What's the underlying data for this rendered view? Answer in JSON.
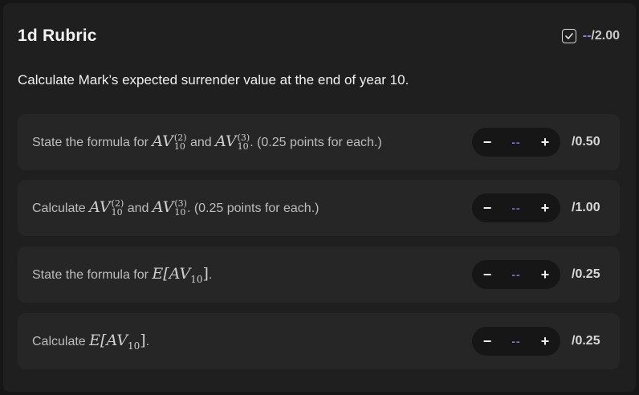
{
  "header": {
    "title": "1d Rubric",
    "score_current": "--",
    "score_total": "/2.00"
  },
  "question": "Calculate Mark’s expected surrender value at the end of year 10.",
  "items": [
    {
      "prefix": "State the formula for ",
      "sym1": "AV",
      "sup1": "(2)",
      "sub1": "10",
      "mid": " and ",
      "sym2": "AV",
      "sup2": "(3)",
      "sub2": "10",
      "suffix": ". (0.25 points for each.)",
      "value": "--",
      "max": "/0.50"
    },
    {
      "prefix": "Calculate ",
      "sym1": "AV",
      "sup1": "(2)",
      "sub1": "10",
      "mid": " and ",
      "sym2": "AV",
      "sup2": "(3)",
      "sub2": "10",
      "suffix": ". (0.25 points for each.)",
      "value": "--",
      "max": "/1.00"
    },
    {
      "prefix": "State the formula for ",
      "expr": "E[AV",
      "expr_sub": "10",
      "expr_close": "]",
      "suffix": ".",
      "value": "--",
      "max": "/0.25"
    },
    {
      "prefix": "Calculate ",
      "expr": "E[AV",
      "expr_sub": "10",
      "expr_close": "]",
      "suffix": ".",
      "value": "--",
      "max": "/0.25"
    }
  ],
  "stepper": {
    "minus": "−",
    "plus": "+"
  },
  "icons": {
    "score": "checkbox-icon"
  }
}
